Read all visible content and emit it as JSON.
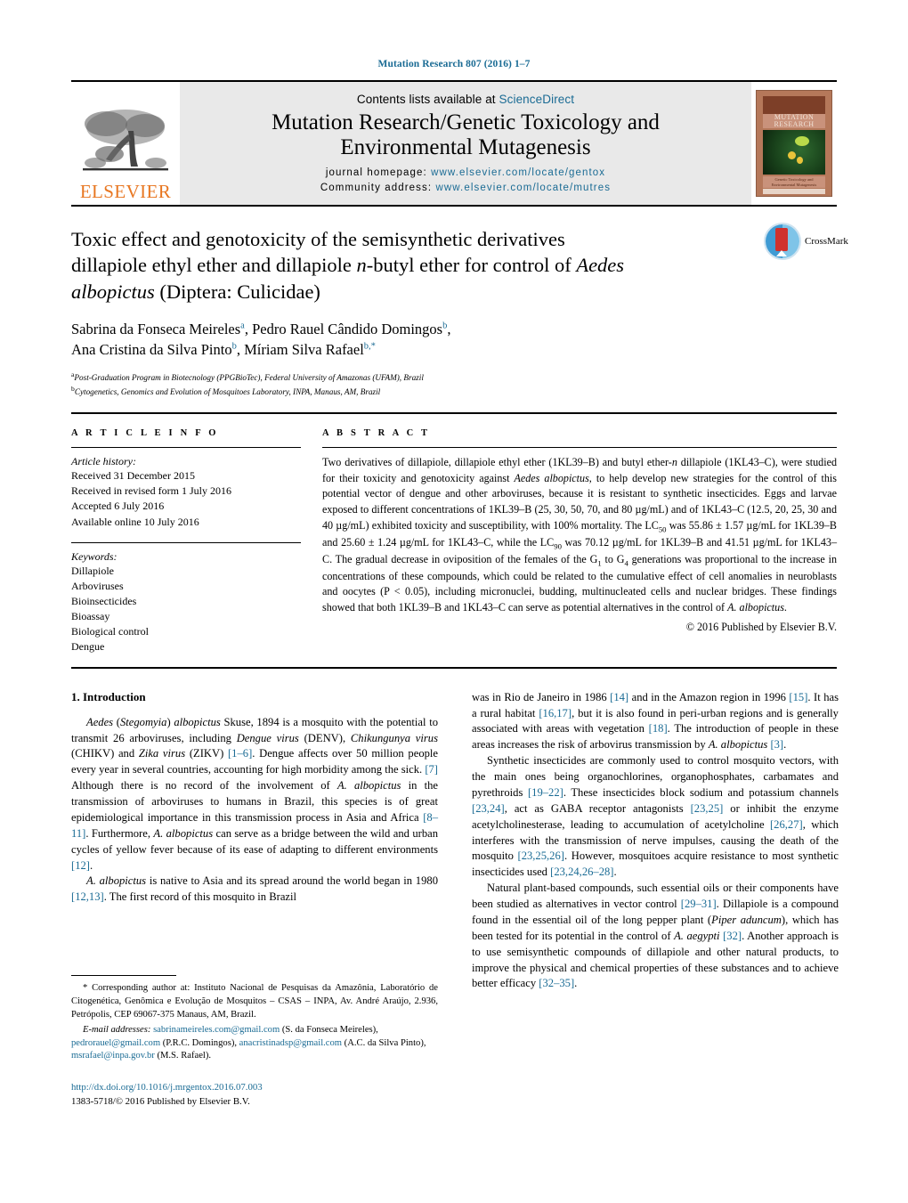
{
  "running_head": "Mutation Research 807 (2016) 1–7",
  "masthead": {
    "publisher_logo_text": "ELSEVIER",
    "contents_prefix": "Contents lists available at",
    "contents_link": "ScienceDirect",
    "journal_title_line1": "Mutation Research/Genetic Toxicology and",
    "journal_title_line2": "Environmental Mutagenesis",
    "homepage_label": "journal homepage:",
    "homepage_url": "www.elsevier.com/locate/gentox",
    "community_label": "Community address:",
    "community_url": "www.elsevier.com/locate/mutres",
    "cover_title_line1": "MUTATION",
    "cover_title_line2": "RESEARCH",
    "cover_caption_line1": "Genetic Toxicology and",
    "cover_caption_line2": "Environmental Mutagenesis"
  },
  "title": {
    "line1": "Toxic effect and genotoxicity of the semisynthetic derivatives",
    "line2_a": "dillapiole ethyl ether and dillapiole ",
    "line2_italic": "n",
    "line2_b": "-butyl ether for control of ",
    "line2_species": "Aedes",
    "line3_species": "albopictus",
    "line3_rest": " (Diptera: Culicidae)"
  },
  "crossmark": {
    "label": "CrossMark"
  },
  "authors": {
    "line1": "Sabrina da Fonseca Meireles",
    "line1_sup": "a",
    "line1_b": ", Pedro Rauel Cândido Domingos",
    "line1_sup_b": "b",
    "line1_tail": ",",
    "line2": "Ana Cristina da Silva Pinto",
    "line2_sup": "b",
    "line2_b": ", Míriam Silva Rafael",
    "line2_sup_b": "b,*"
  },
  "affiliations": [
    {
      "marker": "a",
      "text": "Post-Graduation Program in Biotecnology (PPGBioTec), Federal University of Amazonas (UFAM), Brazil"
    },
    {
      "marker": "b",
      "text": "Cytogenetics, Genomics and Evolution of Mosquitoes Laboratory, INPA, Manaus, AM, Brazil"
    }
  ],
  "article_info": {
    "heading": "A R T I C L E   I N F O",
    "history_title": "Article history:",
    "history": [
      "Received 31 December 2015",
      "Received in revised form 1 July 2016",
      "Accepted 6 July 2016",
      "Available online 10 July 2016"
    ],
    "keywords_title": "Keywords:",
    "keywords": [
      "Dillapiole",
      "Arboviruses",
      "Bioinsecticides",
      "Bioassay",
      "Biological control",
      "Dengue"
    ]
  },
  "abstract": {
    "heading": "A B S T R A C T",
    "body_html": "Two derivatives of dillapiole, dillapiole ethyl ether (1KL39–B) and butyl ether-<i>n</i> dillapiole (1KL43–C), were studied for their toxicity and genotoxicity against <i>Aedes albopictus</i>, to help develop new strategies for the control of this potential vector of dengue and other arboviruses, because it is resistant to synthetic insecticides. Eggs and larvae exposed to different concentrations of 1KL39–B (25, 30, 50, 70, and 80 &#181;g/mL) and of 1KL43–C (12.5, 20, 25, 30 and 40 &#181;g/mL) exhibited toxicity and susceptibility, with 100% mortality. The LC<sub>50</sub> was 55.86 &#177; 1.57 &#181;g/mL for 1KL39–B and 25.60 &#177; 1.24 &#181;g/mL for 1KL43–C, while the LC<sub>90</sub> was 70.12 &#181;g/mL for 1KL39–B and 41.51 &#181;g/mL for 1KL43–C. The gradual decrease in oviposition of the females of the G<sub>1</sub> to G<sub>4</sub> generations was proportional to the increase in concentrations of these compounds, which could be related to the cumulative effect of cell anomalies in neuroblasts and oocytes (P &lt; 0.05), including micronuclei, budding, multinucleated cells and nuclear bridges. These findings showed that both 1KL39–B and 1KL43–C can serve as potential alternatives in the control of <i>A. albopictus</i>.",
    "copyright": "© 2016 Published by Elsevier B.V."
  },
  "intro": {
    "heading": "1. Introduction",
    "left_p1_html": "<i>Aedes</i> (<i>Stegomyia</i>) <i>albopictus</i> Skuse, 1894 is a mosquito with the potential to transmit 26 arboviruses, including <i>Dengue virus</i> (DENV), <i>Chikungunya virus</i> (CHIKV) and <i>Zika virus</i> (ZIKV) <span class=\"ref\">[1–6]</span>. Dengue affects over 50 million people every year in several countries, accounting for high morbidity among the sick. <span class=\"ref\">[7]</span> Although there is no record of the involvement of <i>A. albopictus</i> in the transmission of arboviruses to humans in Brazil, this species is of great epidemiological importance in this transmission process in Asia and Africa <span class=\"ref\">[8–11]</span>. Furthermore, <i>A. albopictus</i> can serve as a bridge between the wild and urban cycles of yellow fever because of its ease of adapting to different environments <span class=\"ref\">[12]</span>.",
    "left_p2_html": "<i>A. albopictus</i> is native to Asia and its spread around the world began in 1980 <span class=\"ref\">[12,13]</span>. The first record of this mosquito in Brazil",
    "right_p1_html": "was in Rio de Janeiro in 1986 <span class=\"ref\">[14]</span> and in the Amazon region in 1996 <span class=\"ref\">[15]</span>. It has a rural habitat <span class=\"ref\">[16,17]</span>, but it is also found in peri-urban regions and is generally associated with areas with vegetation <span class=\"ref\">[18]</span>. The introduction of people in these areas increases the risk of arbovirus transmission by <i>A. albopictus</i> <span class=\"ref\">[3]</span>.",
    "right_p2_html": "Synthetic insecticides are commonly used to control mosquito vectors, with the main ones being organochlorines, organophosphates, carbamates and pyrethroids <span class=\"ref\">[19–22]</span>. These insecticides block sodium and potassium channels <span class=\"ref\">[23,24]</span>, act as GABA receptor antagonists <span class=\"ref\">[23,25]</span> or inhibit the enzyme acetylcholinesterase, leading to accumulation of acetylcholine <span class=\"ref\">[26,27]</span>, which interferes with the transmission of nerve impulses, causing the death of the mosquito <span class=\"ref\">[23,25,26]</span>. However, mosquitoes acquire resistance to most synthetic insecticides used <span class=\"ref\">[23,24,26–28]</span>.",
    "right_p3_html": "Natural plant-based compounds, such essential oils or their components have been studied as alternatives in vector control <span class=\"ref\">[29–31]</span>. Dillapiole is a compound found in the essential oil of the long pepper plant (<i>Piper aduncum</i>), which has been tested for its potential in the control of <i>A. aegypti</i> <span class=\"ref\">[32]</span>. Another approach is to use semisynthetic compounds of dillapiole and other natural products, to improve the physical and chemical properties of these substances and to achieve better efficacy <span class=\"ref\">[32–35]</span>."
  },
  "footnotes": {
    "corresponding_html": "* Corresponding author at: Instituto Nacional de Pesquisas da Amazônia, Laboratório de Citogenética, Genômica e Evolução de Mosquitos – CSAS – INPA, Av. André Araújo, 2.936, Petrópolis, CEP 69067-375 Manaus, AM, Brazil.",
    "emails_html": "<i>E-mail addresses:</i> <span class=\"email\">sabrinameireles.com@gmail.com</span> (S. da Fonseca Meireles), <span class=\"email\">pedrorauel@gmail.com</span> (P.R.C. Domingos), <span class=\"email\">anacristinadsp@gmail.com</span> (A.C. da Silva Pinto), <span class=\"email\">msrafael@inpa.gov.br</span> (M.S. Rafael)."
  },
  "doi": {
    "url": "http://dx.doi.org/10.1016/j.mrgentox.2016.07.003",
    "issn_line": "1383-5718/© 2016 Published by Elsevier B.V."
  },
  "colors": {
    "link": "#1a6b94",
    "elsevier_orange": "#E87722",
    "masthead_grey": "#e9e9e9"
  }
}
